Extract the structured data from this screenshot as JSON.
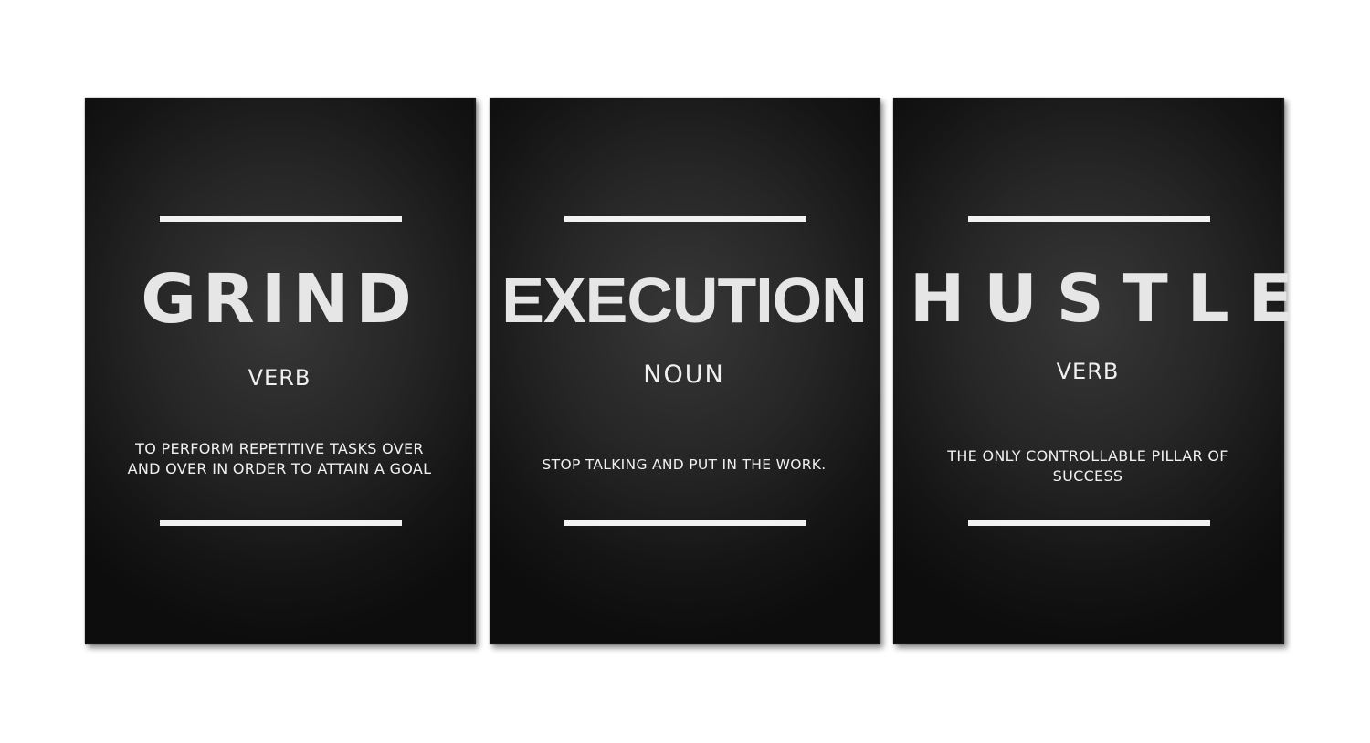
{
  "panels": [
    {
      "word": "GRIND",
      "part_of_speech": "VERB",
      "definition_line_1": "TO PERFORM REPETITIVE TASKS OVER",
      "definition_line_2": "AND OVER IN ORDER TO ATTAIN A GOAL"
    },
    {
      "word": "EXECUTION",
      "part_of_speech": "NOUN",
      "definition_line_1": "STOP TALKING AND PUT IN THE WORK."
    },
    {
      "word": "HUSTLE",
      "part_of_speech": "VERB",
      "definition_line_1": "THE ONLY CONTROLLABLE PILLAR OF",
      "definition_line_2": "SUCCESS"
    }
  ],
  "colors": {
    "background": "#ffffff",
    "panel": "#262626",
    "text": "#e6e6e6",
    "rule": "#f2f2f2"
  }
}
